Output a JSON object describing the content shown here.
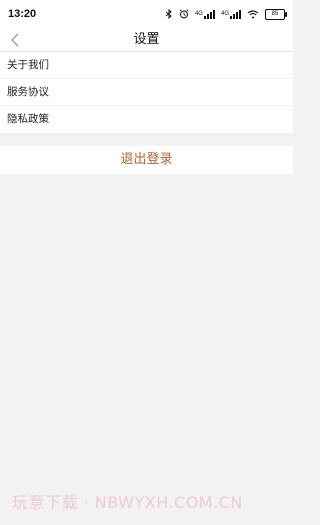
{
  "status_bar": {
    "time": "13:20",
    "network_label_1": "4G",
    "network_label_2": "4G",
    "battery": "85",
    "icons": [
      "bluetooth-icon",
      "alarm-icon",
      "signal-icon",
      "signal-icon",
      "wifi-icon",
      "battery-icon"
    ]
  },
  "nav": {
    "title": "设置",
    "back_icon": "chevron-left-icon"
  },
  "menu": {
    "items": [
      {
        "label": "关于我们"
      },
      {
        "label": "服务协议"
      },
      {
        "label": "隐私政策"
      }
    ]
  },
  "logout": {
    "label": "退出登录",
    "color": "#c0612b"
  },
  "watermark": {
    "text": "玩意下载 · NBWYXH.COM.CN"
  },
  "colors": {
    "background": "#f2f2f2",
    "surface": "#ffffff",
    "accent": "#c0612b"
  }
}
